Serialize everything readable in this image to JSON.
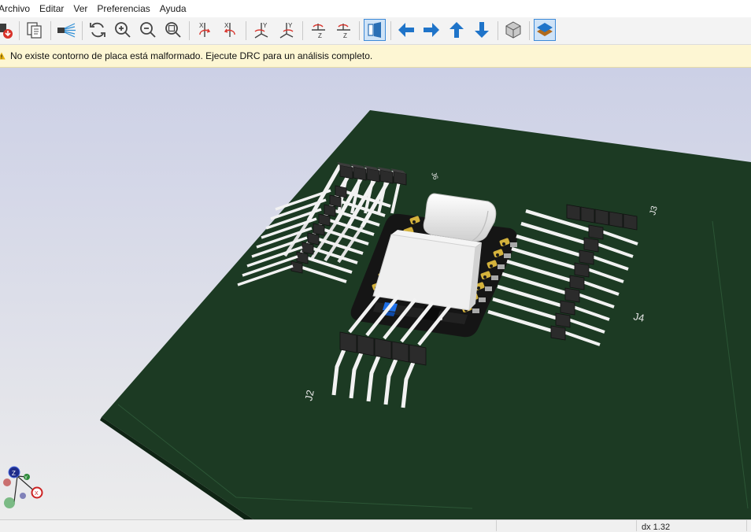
{
  "menu": [
    "Archivo",
    "Editar",
    "Ver",
    "Preferencias",
    "Ayuda"
  ],
  "toolbar": {
    "buttons": [
      {
        "name": "render-options-icon"
      },
      {
        "name": "copy-3d-image-icon"
      },
      {
        "name": "raytracing-icon"
      },
      {
        "name": "reload-board-icon"
      },
      {
        "name": "zoom-in-icon"
      },
      {
        "name": "zoom-out-icon"
      },
      {
        "name": "zoom-fit-icon"
      },
      {
        "name": "rotate-x-cw-icon"
      },
      {
        "name": "rotate-x-ccw-icon"
      },
      {
        "name": "rotate-y-cw-icon"
      },
      {
        "name": "rotate-y-ccw-icon"
      },
      {
        "name": "rotate-z-cw-icon"
      },
      {
        "name": "rotate-z-ccw-icon"
      },
      {
        "name": "flip-board-icon"
      },
      {
        "name": "pan-left-icon"
      },
      {
        "name": "pan-right-icon"
      },
      {
        "name": "pan-up-icon"
      },
      {
        "name": "pan-down-icon"
      },
      {
        "name": "orthographic-icon"
      },
      {
        "name": "layers-icon"
      }
    ],
    "active": [
      "flip-board-icon",
      "layers-icon"
    ]
  },
  "infobar": {
    "message": "No existe contorno de placa está malformado. Ejecute DRC para un análisis completo."
  },
  "viewport": {
    "labels": {
      "j6": "J6",
      "j3": "J3",
      "j4": "J4",
      "j2": "J2"
    },
    "axes": {
      "x": "X",
      "y": "Y",
      "z": "Z"
    },
    "colors": {
      "board": "#1c3a23",
      "background_top": "#ccd0e6",
      "background_bottom": "#ececec"
    }
  },
  "status": {
    "zoom": "dx 1.32"
  }
}
